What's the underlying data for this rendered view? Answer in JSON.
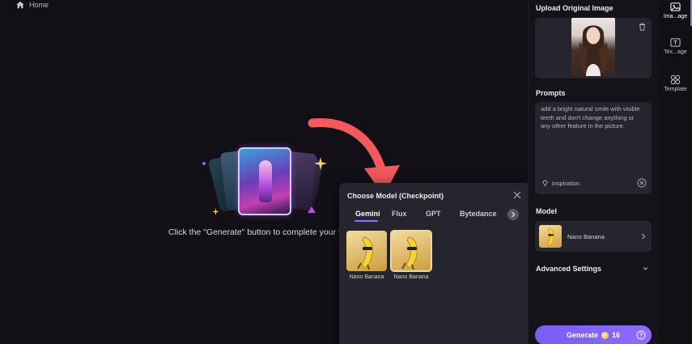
{
  "breadcrumb": {
    "home_label": "Home"
  },
  "canvas": {
    "empty_hint": "Click the \"Generate\" button to complete your firs"
  },
  "model_popup": {
    "title": "Choose Model (Checkpoint)",
    "tabs": [
      {
        "label": "Gemini",
        "active": true
      },
      {
        "label": "Flux"
      },
      {
        "label": "GPT"
      },
      {
        "label": "Bytedance"
      }
    ],
    "models": [
      {
        "name": "Nano Banana"
      },
      {
        "name": "Nano Banana",
        "selected": true
      }
    ]
  },
  "panel": {
    "upload_title": "Upload Original Image",
    "prompts_title": "Prompts",
    "prompt_text": "add a bright natural smile with visible teeth and don't change anything or any other feature in the picture.",
    "inspiration_label": "inspiration",
    "model_title": "Model",
    "model_name": "Nano Banana",
    "advanced_title": "Advanced Settings",
    "generate_label": "Generate",
    "credits": "16"
  },
  "rail": {
    "items": [
      {
        "label": "Ima...age",
        "icon": "image-icon",
        "active": true
      },
      {
        "label": "Tex...age",
        "icon": "text-image-icon"
      },
      {
        "label": "Template",
        "icon": "template-icon"
      }
    ]
  },
  "colors": {
    "accent": "#8d73ff",
    "arrow": "#f05a5a",
    "panel_bg": "#15131a",
    "card_bg": "#26242c"
  }
}
